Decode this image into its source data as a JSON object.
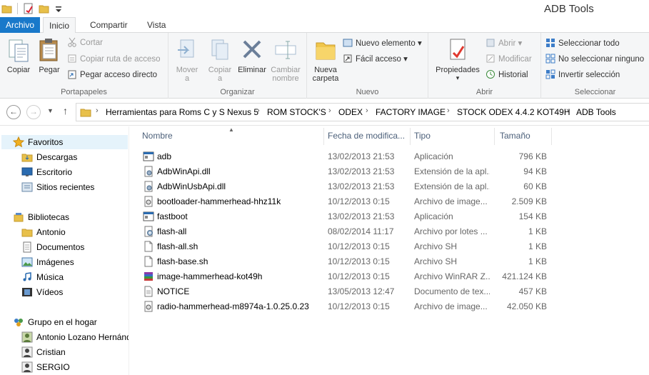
{
  "window": {
    "title": "ADB Tools"
  },
  "tabs": {
    "file": "Archivo",
    "home": "Inicio",
    "share": "Compartir",
    "view": "Vista"
  },
  "ribbon": {
    "clipboard": {
      "label": "Portapapeles",
      "copy": "Copiar",
      "paste": "Pegar",
      "cut": "Cortar",
      "copy_path": "Copiar ruta de acceso",
      "paste_shortcut": "Pegar acceso directo"
    },
    "organize": {
      "label": "Organizar",
      "move_1": "Mover",
      "move_2": "a",
      "copy_1": "Copiar",
      "copy_2": "a",
      "delete": "Eliminar",
      "rename_1": "Cambiar",
      "rename_2": "nombre"
    },
    "new": {
      "label": "Nuevo",
      "folder_1": "Nueva",
      "folder_2": "carpeta",
      "new_item": "Nuevo elemento",
      "easy_access": "Fácil acceso"
    },
    "open": {
      "label": "Abrir",
      "properties": "Propiedades",
      "open": "Abrir",
      "edit": "Modificar",
      "history": "Historial"
    },
    "select": {
      "label": "Seleccionar",
      "select_all": "Seleccionar todo",
      "select_none": "No seleccionar ninguno",
      "invert": "Invertir selección"
    }
  },
  "address": {
    "crumbs": [
      "Herramientas para Roms C y S Nexus 5",
      "ROM STOCK'S",
      "ODEX",
      "FACTORY IMAGE",
      "STOCK ODEX 4.4.2 KOT49H",
      "ADB Tools"
    ]
  },
  "nav": {
    "favorites": "Favoritos",
    "downloads": "Descargas",
    "desktop": "Escritorio",
    "recent": "Sitios recientes",
    "libraries": "Bibliotecas",
    "antonio": "Antonio",
    "documents": "Documentos",
    "images": "Imágenes",
    "music": "Música",
    "videos": "Vídeos",
    "homegroup": "Grupo en el hogar",
    "hg_user1": "Antonio Lozano Hernández",
    "hg_user2": "Cristian",
    "hg_user3": "SERGIO"
  },
  "columns": {
    "name": "Nombre",
    "date": "Fecha de modifica...",
    "type": "Tipo",
    "size": "Tamaño"
  },
  "files": [
    {
      "name": "adb",
      "date": "13/02/2013 21:53",
      "type": "Aplicación",
      "size": "796 KB",
      "icon": "application-icon"
    },
    {
      "name": "AdbWinApi.dll",
      "date": "13/02/2013 21:53",
      "type": "Extensión de la apl...",
      "size": "94 KB",
      "icon": "dll-icon"
    },
    {
      "name": "AdbWinUsbApi.dll",
      "date": "13/02/2013 21:53",
      "type": "Extensión de la apl...",
      "size": "60 KB",
      "icon": "dll-icon"
    },
    {
      "name": "bootloader-hammerhead-hhz11k",
      "date": "10/12/2013 0:15",
      "type": "Archivo de image...",
      "size": "2.509 KB",
      "icon": "disk-image-icon"
    },
    {
      "name": "fastboot",
      "date": "13/02/2013 21:53",
      "type": "Aplicación",
      "size": "154 KB",
      "icon": "application-icon"
    },
    {
      "name": "flash-all",
      "date": "08/02/2014 11:17",
      "type": "Archivo por lotes ...",
      "size": "1 KB",
      "icon": "batch-icon"
    },
    {
      "name": "flash-all.sh",
      "date": "10/12/2013 0:15",
      "type": "Archivo SH",
      "size": "1 KB",
      "icon": "generic-file-icon"
    },
    {
      "name": "flash-base.sh",
      "date": "10/12/2013 0:15",
      "type": "Archivo SH",
      "size": "1 KB",
      "icon": "generic-file-icon"
    },
    {
      "name": "image-hammerhead-kot49h",
      "date": "10/12/2013 0:15",
      "type": "Archivo WinRAR Z...",
      "size": "421.124 KB",
      "icon": "winrar-icon"
    },
    {
      "name": "NOTICE",
      "date": "13/05/2013 12:47",
      "type": "Documento de tex...",
      "size": "457 KB",
      "icon": "text-file-icon"
    },
    {
      "name": "radio-hammerhead-m8974a-1.0.25.0.23",
      "date": "10/12/2013 0:15",
      "type": "Archivo de image...",
      "size": "42.050 KB",
      "icon": "disk-image-icon"
    }
  ],
  "colors": {
    "file_tab": "#1979ca",
    "ribbon_bg": "#f5f6f7",
    "header_text": "#4c607a"
  }
}
